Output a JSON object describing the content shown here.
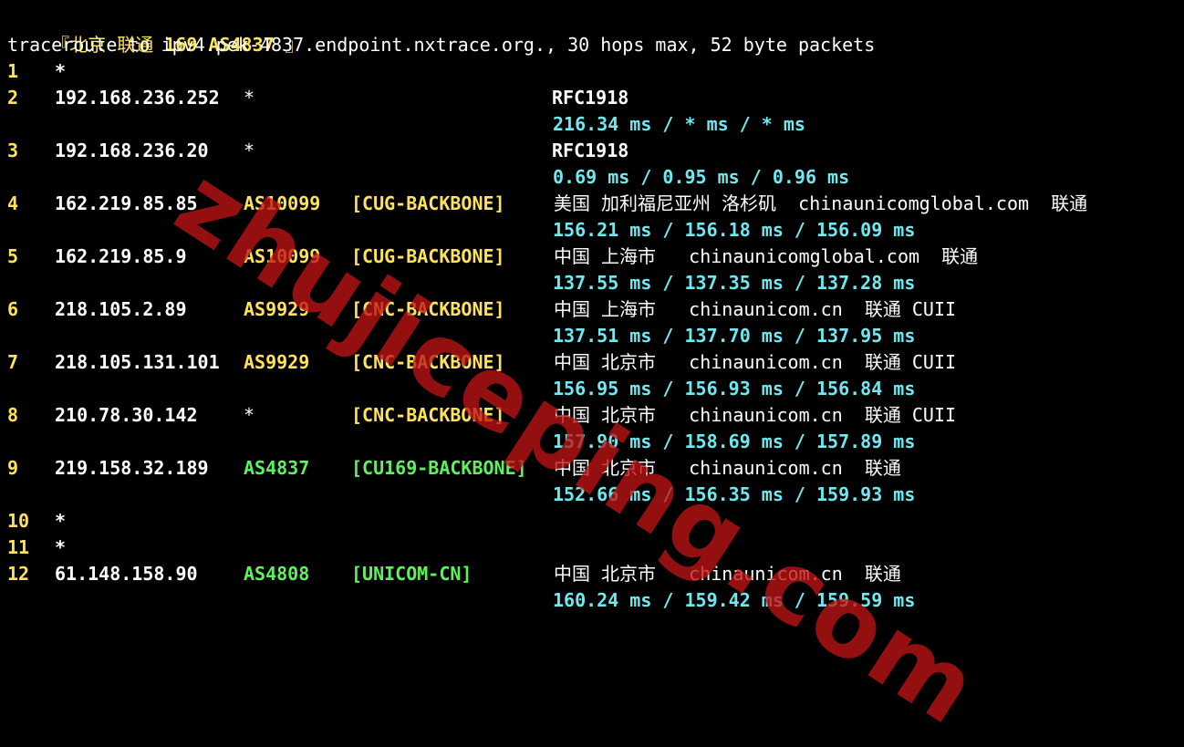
{
  "header": {
    "target_label_pre": "『北京 联通 ",
    "target_label_bold": "169 AS4837",
    "target_label_post": " 』",
    "traceroute_line": "traceroute to ipv4.pek-4837.endpoint.nxtrace.org., 30 hops max, 52 byte packets"
  },
  "watermark": "zhujiceping.com",
  "colors": {
    "background": "#000000",
    "hop_number": "#ffe357",
    "asn_yellow": "#ffe357",
    "asn_green": "#5bf25b",
    "latency": "#6fe8f0",
    "watermark": "#be1414"
  },
  "hops": [
    {
      "n": "1",
      "ip": "*",
      "asn": "",
      "asn_color": "",
      "tag": "",
      "tag_color": "",
      "geo": "",
      "lat": ""
    },
    {
      "n": "2",
      "ip": "192.168.236.252",
      "asn": "*",
      "asn_color": "white",
      "tag": "",
      "tag_color": "",
      "geo": "RFC1918",
      "lat": "216.34 ms / * ms / * ms"
    },
    {
      "n": "3",
      "ip": "192.168.236.20",
      "asn": "*",
      "asn_color": "white",
      "tag": "",
      "tag_color": "",
      "geo": "RFC1918",
      "lat": "0.69 ms / 0.95 ms / 0.96 ms"
    },
    {
      "n": "4",
      "ip": "162.219.85.85",
      "asn": "AS10099",
      "asn_color": "yellow",
      "tag": "[CUG-BACKBONE]",
      "tag_color": "yellow",
      "geo": "美国 加利福尼亚州 洛杉矶  chinaunicomglobal.com  联通",
      "lat": "156.21 ms / 156.18 ms / 156.09 ms"
    },
    {
      "n": "5",
      "ip": "162.219.85.9",
      "asn": "AS10099",
      "asn_color": "yellow",
      "tag": "[CUG-BACKBONE]",
      "tag_color": "yellow",
      "geo": "中国 上海市   chinaunicomglobal.com  联通",
      "lat": "137.55 ms / 137.35 ms / 137.28 ms"
    },
    {
      "n": "6",
      "ip": "218.105.2.89",
      "asn": "AS9929",
      "asn_color": "yellow",
      "tag": "[CNC-BACKBONE]",
      "tag_color": "yellow",
      "geo": "中国 上海市   chinaunicom.cn  联通 CUII",
      "lat": "137.51 ms / 137.70 ms / 137.95 ms"
    },
    {
      "n": "7",
      "ip": "218.105.131.101",
      "asn": "AS9929",
      "asn_color": "yellow",
      "tag": "[CNC-BACKBONE]",
      "tag_color": "yellow",
      "geo": "中国 北京市   chinaunicom.cn  联通 CUII",
      "lat": "156.95 ms / 156.93 ms / 156.84 ms"
    },
    {
      "n": "8",
      "ip": "210.78.30.142",
      "asn": "*",
      "asn_color": "white",
      "tag": "[CNC-BACKBONE]",
      "tag_color": "yellow",
      "geo": "中国 北京市   chinaunicom.cn  联通 CUII",
      "lat": "157.90 ms / 158.69 ms / 157.89 ms"
    },
    {
      "n": "9",
      "ip": "219.158.32.189",
      "asn": "AS4837",
      "asn_color": "green",
      "tag": "[CU169-BACKBONE]",
      "tag_color": "green",
      "geo": "中国 北京市   chinaunicom.cn  联通",
      "lat": "152.66 ms / 156.35 ms / 159.93 ms"
    },
    {
      "n": "10",
      "ip": "*",
      "asn": "",
      "asn_color": "",
      "tag": "",
      "tag_color": "",
      "geo": "",
      "lat": ""
    },
    {
      "n": "11",
      "ip": "*",
      "asn": "",
      "asn_color": "",
      "tag": "",
      "tag_color": "",
      "geo": "",
      "lat": ""
    },
    {
      "n": "12",
      "ip": "61.148.158.90",
      "asn": "AS4808",
      "asn_color": "green",
      "tag": "[UNICOM-CN]",
      "tag_color": "green",
      "geo": "中国 北京市   chinaunicom.cn  联通",
      "lat": "160.24 ms / 159.42 ms / 159.59 ms"
    }
  ]
}
